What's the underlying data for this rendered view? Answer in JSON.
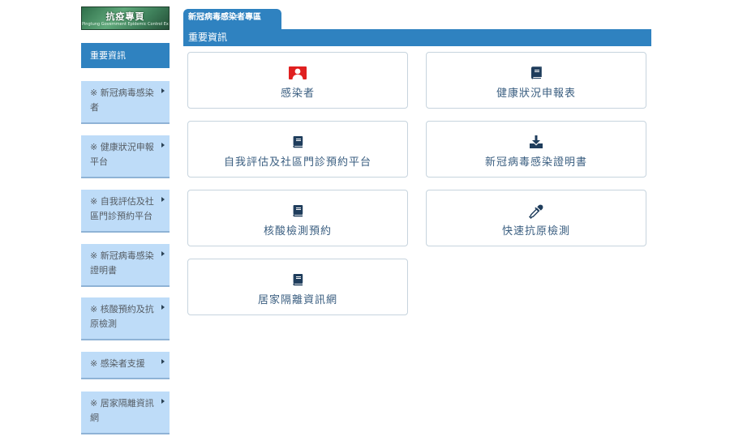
{
  "logo": {
    "title": "抗疫專頁",
    "subtitle": "Pingtung Government Epidemic Control Exclusive"
  },
  "sidebar": {
    "items": [
      {
        "label": "重要資訊",
        "active": true
      },
      {
        "line1": "※ 新冠病毒感染",
        "line2": "者"
      },
      {
        "line1": "※ 健康狀況申報",
        "line2": "平台"
      },
      {
        "line1": "※ 自我評估及社",
        "line2": "區門診預約平台"
      },
      {
        "line1": "※ 新冠病毒感染",
        "line2": "證明書"
      },
      {
        "line1": "※ 核酸預約及抗",
        "line2": "原檢測"
      },
      {
        "line1": "※ 感染者支援",
        "line2": ""
      },
      {
        "line1": "※ 居家隔離資訊",
        "line2": "網"
      }
    ]
  },
  "header": {
    "tab_title": "新冠病毒感染者專區",
    "section_title": "重要資訊"
  },
  "cards": [
    {
      "label": "感染者",
      "icon": "user-icon"
    },
    {
      "label": "健康狀況申報表",
      "icon": "book-icon"
    },
    {
      "label": "自我評估及社區門診預約平台",
      "icon": "book-icon"
    },
    {
      "label": "新冠病毒感染證明書",
      "icon": "download-icon"
    },
    {
      "label": "核酸檢測預約",
      "icon": "book-icon"
    },
    {
      "label": "快速抗原檢測",
      "icon": "dropper-icon"
    },
    {
      "label": "居家隔離資訊網",
      "icon": "book-icon"
    }
  ],
  "colors": {
    "primary": "#2f82c0",
    "sidebar_item": "#bedcf8",
    "user_icon": "#e02020"
  }
}
